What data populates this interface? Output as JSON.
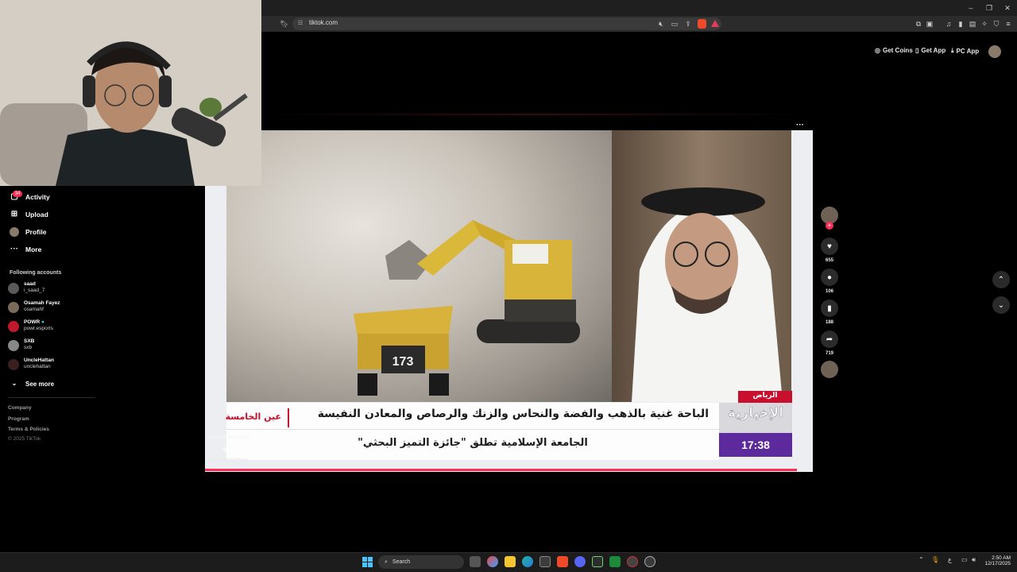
{
  "browser": {
    "url": "tiktok.com"
  },
  "header": {
    "get_coins": "Get Coins",
    "get_app": "Get App",
    "pc_app": "PC App"
  },
  "sidebar": {
    "activity": "Activity",
    "activity_badge": "34",
    "upload": "Upload",
    "profile": "Profile",
    "more": "More",
    "following_heading": "Following accounts",
    "accounts": [
      {
        "name": "saad",
        "handle": "i_saad_7"
      },
      {
        "name": "Osamah Fayez",
        "handle": "osamahf"
      },
      {
        "name": "POWR",
        "handle": "powr.esports"
      },
      {
        "name": "SXB",
        "handle": "sxb"
      },
      {
        "name": "UncleHattan",
        "handle": "unclehattan"
      }
    ],
    "see_more": "See more",
    "footer": [
      "Company",
      "Program",
      "Terms & Policies",
      "© 2025 TikTok"
    ]
  },
  "video": {
    "overlay_user": "ismaiil.al.ameri",
    "caption": "#معادن #عين_الخامسة #وزارة_الصناعة_والمعادن يارب بلغوا منجم ذهب عند بيتنا 😂",
    "see_translation": "See translation",
    "news": {
      "channel": "الإخبارية",
      "program": "عين الخامسة",
      "location": "الرياض",
      "headline": "الباحة غنية بالذهب والفضة والنحاس والزنك والرصاص والمعادن النفيسة",
      "ticker": "الجامعة الإسلامية تطلق \"جائزة التميز البحثي\"",
      "time": "17:38",
      "truck_number": "173"
    }
  },
  "actions": {
    "likes": "655",
    "comments": "106",
    "saves": "188",
    "shares": "719"
  },
  "taskbar": {
    "search": "Search",
    "lang": "ع",
    "time": "2:50 AM",
    "date": "12/17/2025"
  }
}
